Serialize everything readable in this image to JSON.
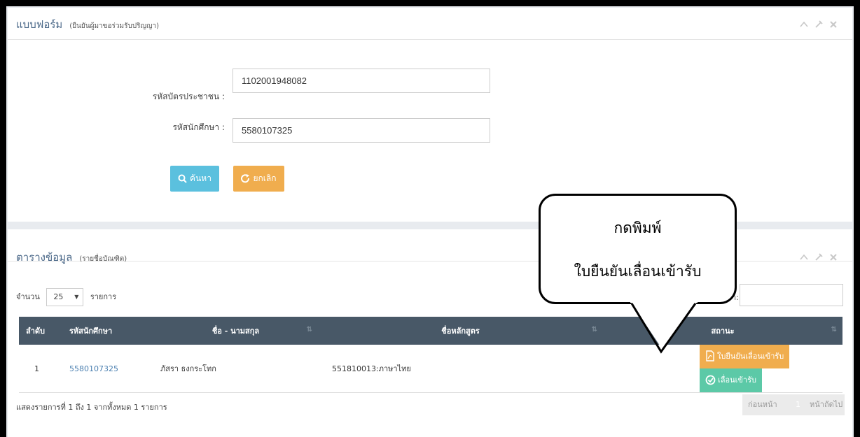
{
  "form_panel": {
    "title": "แบบฟอร์ม",
    "subtitle": "(ยืนยันผู้มาขอร่วมรับปริญญา)",
    "tools": "^ ⚡ ✖",
    "id_card_label": "รหัสบัตรประชาชน :",
    "id_card_value": "1102001948082",
    "student_id_label": "รหัสนักศึกษา :",
    "student_id_value": "5580107325",
    "search_button": "ค้นหา",
    "cancel_button": "ยกเลิก"
  },
  "table_panel": {
    "title": "ตารางข้อมูล",
    "subtitle": "(รายชื่อบัณฑิต)",
    "length_prefix": "จำนวน",
    "length_value": "25",
    "length_suffix": "รายการ",
    "search_label": "า:",
    "columns": [
      "ลำดับ",
      "รหัสนักศึกษา",
      "ชื่อ - นามสกุล",
      "ชื่อหลักสูตร",
      "สถานะ"
    ],
    "rows": [
      {
        "no": "1",
        "student_id": "5580107325",
        "name": "ภัสรา ธงกระโทก",
        "program": "551810013:ภาษาไทย"
      }
    ],
    "cert_button": "ใบยืนยันเลื่อนเข้ารับ",
    "defer_button": "เลื่อนเข้ารับ",
    "info": "แสดงรายการที่ 1 ถึง 1 จากทั้งหมด 1 รายการ",
    "prev": "ก่อนหน้า",
    "page": "1",
    "next": "หน้าถัดไป"
  },
  "callout": {
    "line1": "กดพิมพ์",
    "line2": "ใบยืนยันเลื่อนเข้ารับ"
  },
  "colors": {
    "info": "#5bc0de",
    "warning": "#f0ad4e",
    "success": "#5cc9a7",
    "table_header": "#485867"
  }
}
